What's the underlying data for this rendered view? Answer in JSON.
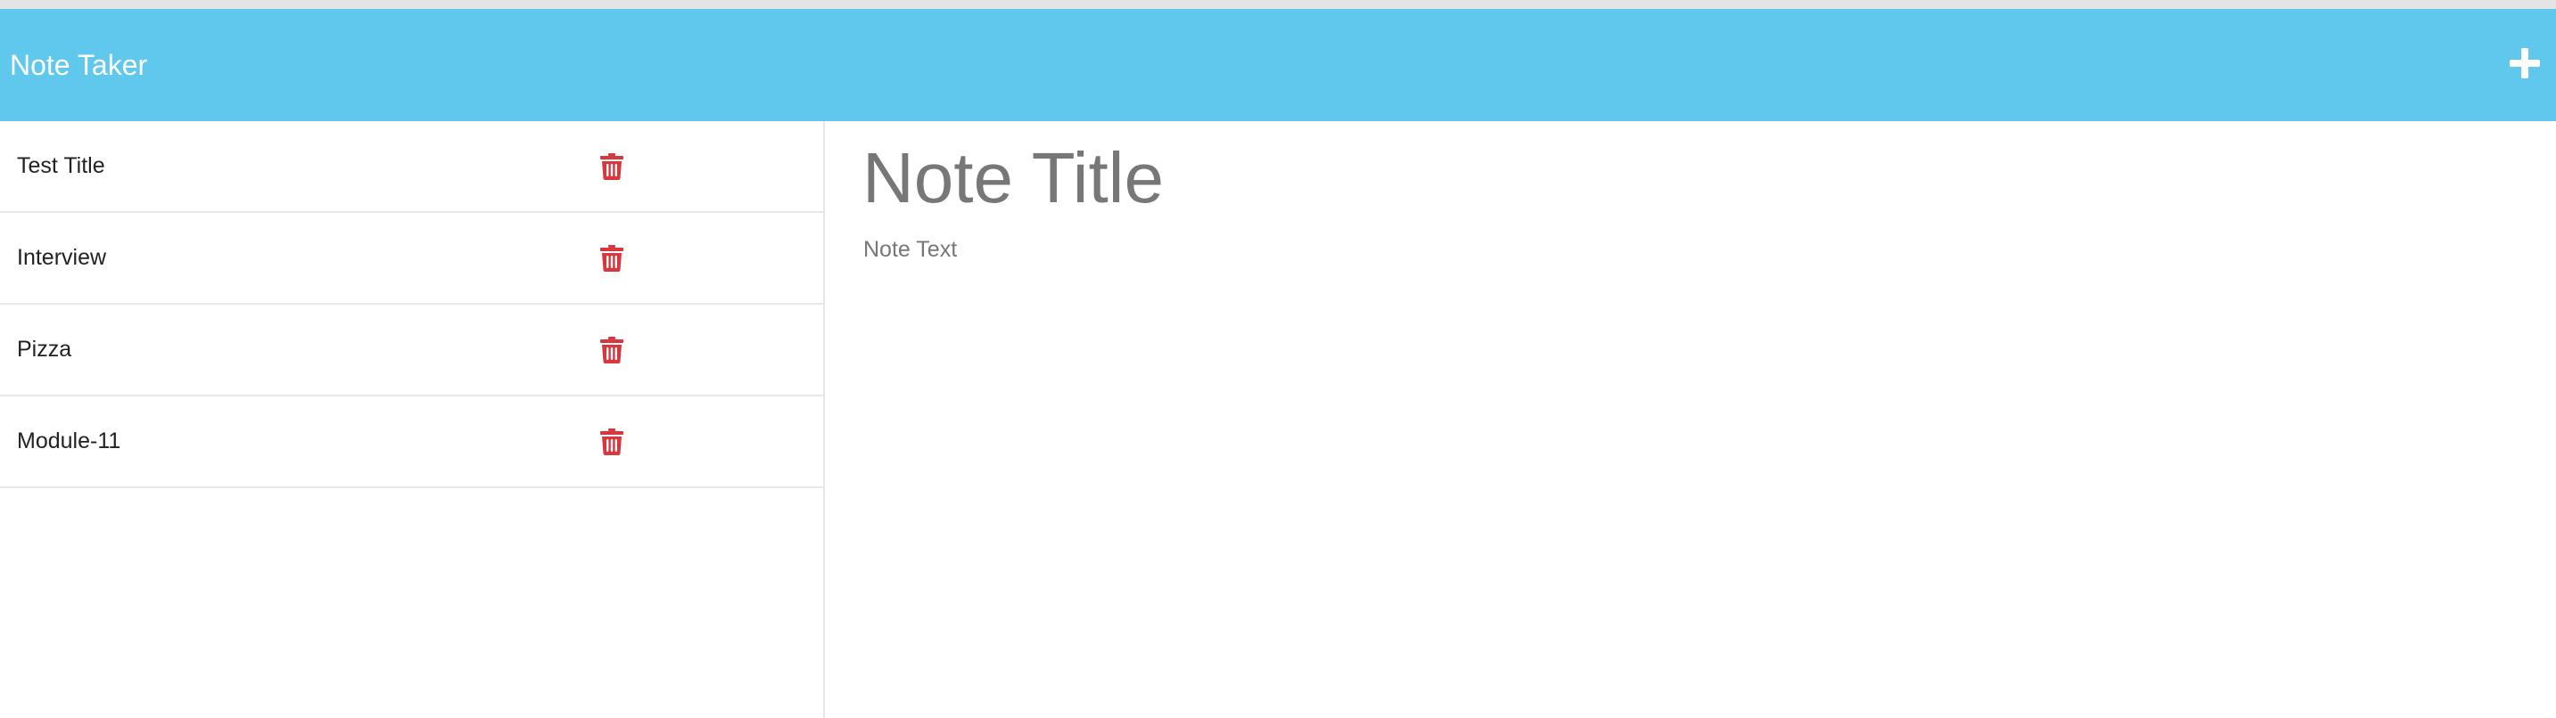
{
  "app": {
    "title": "Note Taker",
    "accent_color": "#5fc8ec",
    "new_note_icon": "plus-icon"
  },
  "notes": [
    {
      "title": "Test Title",
      "delete_icon": "trash-icon"
    },
    {
      "title": "Interview",
      "delete_icon": "trash-icon"
    },
    {
      "title": "Pizza",
      "delete_icon": "trash-icon"
    },
    {
      "title": "Module-11",
      "delete_icon": "trash-icon"
    }
  ],
  "editor": {
    "title_placeholder": "Note Title",
    "title_value": "",
    "text_placeholder": "Note Text",
    "text_value": ""
  },
  "colors": {
    "delete": "#d9363e",
    "placeholder": "#777777"
  }
}
